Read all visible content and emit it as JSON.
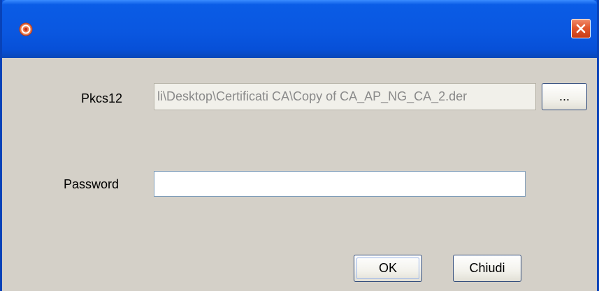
{
  "window": {
    "icon": "app-icon",
    "close_icon": "close-icon"
  },
  "form": {
    "pkcs12_label": "Pkcs12",
    "pkcs12_value": "li\\Desktop\\Certificati CA\\Copy of CA_AP_NG_CA_2.der",
    "browse_label": "...",
    "password_label": "Password",
    "password_value": ""
  },
  "buttons": {
    "ok_label": "OK",
    "close_label": "Chiudi"
  },
  "colors": {
    "titlebar": "#0a57e0",
    "dialog_bg": "#d4d0c8",
    "close_button": "#e2582e"
  }
}
